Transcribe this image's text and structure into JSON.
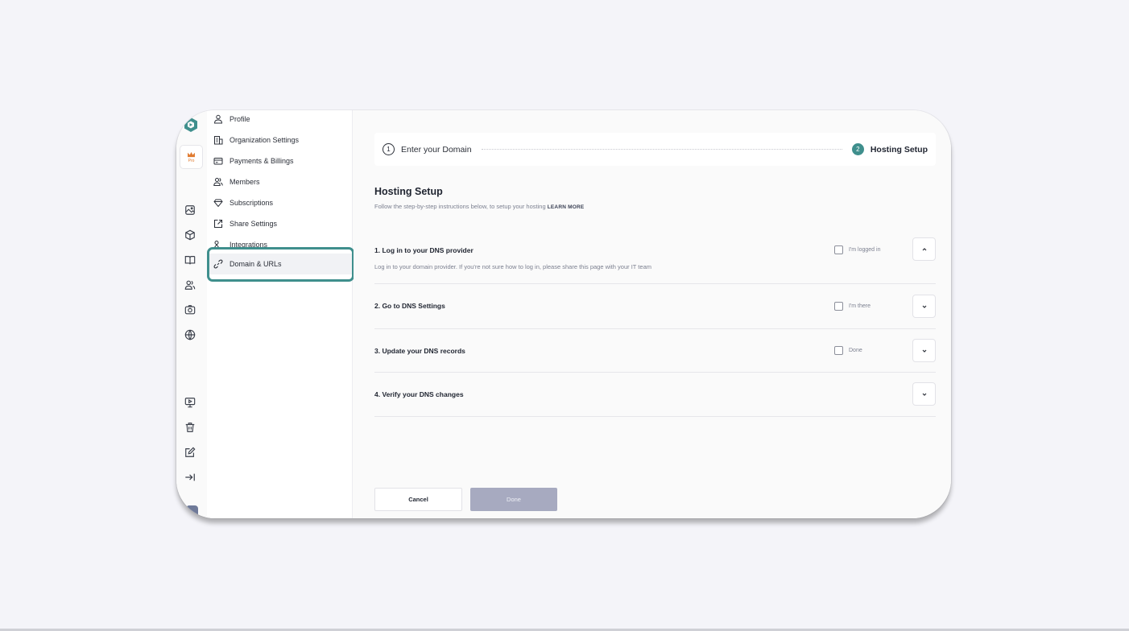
{
  "rail": {
    "pro_label": "Pro",
    "icons": [
      "logo-icon",
      "crown-icon",
      "image-icon",
      "cube-icon",
      "book-icon",
      "users-icon",
      "camera-icon",
      "globe-icon",
      "presentation-icon",
      "trash-icon",
      "edit-icon",
      "collapse-icon"
    ]
  },
  "sidebar": {
    "items": [
      {
        "label": "Profile",
        "icon": "user-icon"
      },
      {
        "label": "Organization Settings",
        "icon": "building-icon"
      },
      {
        "label": "Payments & Billings",
        "icon": "card-icon"
      },
      {
        "label": "Members",
        "icon": "members-icon"
      },
      {
        "label": "Subscriptions",
        "icon": "diamond-icon"
      },
      {
        "label": "Share Settings",
        "icon": "share-icon"
      },
      {
        "label": "Integrations",
        "icon": "integrations-icon"
      },
      {
        "label": "Domain & URLs",
        "icon": "link-icon"
      }
    ],
    "active": "Domain & URLs"
  },
  "stepper": {
    "step1_num": "1",
    "step1_label": "Enter your Domain",
    "step2_num": "2",
    "step2_label": "Hosting Setup"
  },
  "page": {
    "title": "Hosting Setup",
    "subtitle": "Follow the step-by-step instructions below, to setup your hosting",
    "learn_more": "LEARN MORE"
  },
  "steps": [
    {
      "title": "1. Log in to your DNS provider",
      "desc": "Log in to your domain provider. If you're not sure how to log in, please share this page with your IT team",
      "check_label": "I'm logged in",
      "expanded": true
    },
    {
      "title": "2. Go to DNS Settings",
      "check_label": "I'm there",
      "expanded": false
    },
    {
      "title": "3. Update your DNS records",
      "check_label": "Done",
      "expanded": false
    },
    {
      "title": "4. Verify your DNS changes",
      "expanded": false
    }
  ],
  "actions": {
    "cancel": "Cancel",
    "done": "Done"
  },
  "colors": {
    "accent": "#3f8f8d",
    "disabled_button": "#a7aac0",
    "pro_orange": "#e07a2f"
  }
}
